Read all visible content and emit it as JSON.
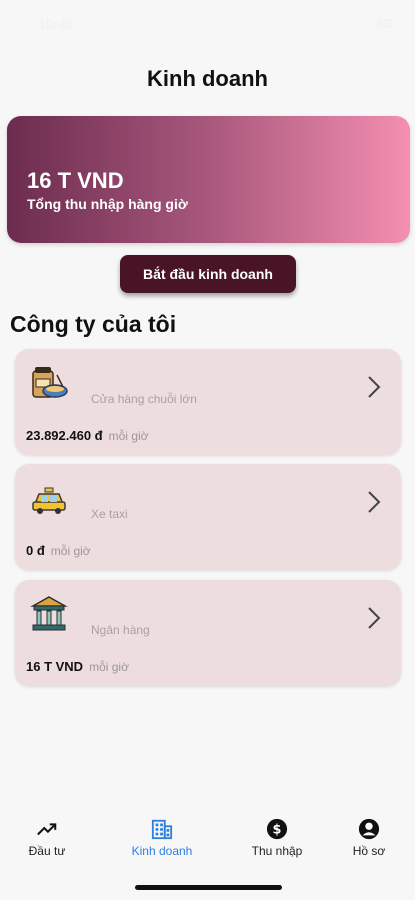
{
  "status": {
    "time": "10:41",
    "right": "4G"
  },
  "header": {
    "title": "Kinh doanh"
  },
  "hero": {
    "amount": "16 T VND",
    "label": "Tổng thu nhập hàng giờ"
  },
  "start_button": {
    "label": "Bắt đầu kinh doanh"
  },
  "section": {
    "title": "Công ty của tôi"
  },
  "companies": [
    {
      "name": "Cửa hàng chuỗi lớn",
      "value": "23.892.460 đ",
      "unit": "mỗi giờ",
      "icon": "food-store-icon"
    },
    {
      "name": "Xe taxi",
      "value": "0 đ",
      "unit": "mỗi giờ",
      "icon": "taxi-icon"
    },
    {
      "name": "Ngân hàng",
      "value": "16 T VND",
      "unit": "mỗi giờ",
      "icon": "bank-icon"
    }
  ],
  "nav": {
    "items": [
      {
        "label": "Đầu tư",
        "icon": "trending-up-icon"
      },
      {
        "label": "Kinh doanh",
        "icon": "building-icon",
        "active": true
      },
      {
        "label": "Thu nhập",
        "icon": "dollar-circle-icon"
      },
      {
        "label": "Hồ sơ",
        "icon": "account-circle-icon"
      }
    ]
  },
  "colors": {
    "accent": "#2f7fdf",
    "button": "#4a1427",
    "card": "#eeddde",
    "hero_start": "#6c2c4e",
    "hero_end": "#f48fb0"
  }
}
